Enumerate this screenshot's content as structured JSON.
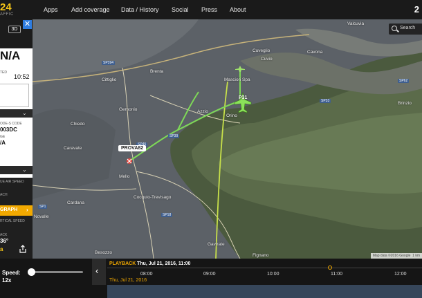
{
  "app": {
    "logo_text": "24",
    "logo_sub": "AFFIC"
  },
  "nav": {
    "items": [
      "Apps",
      "Add coverage",
      "Data / History",
      "Social",
      "Press",
      "About"
    ],
    "corner": "2"
  },
  "panel": {
    "view_3d": "3D",
    "close": "✕",
    "registration": "N/A",
    "time_label": "TED",
    "time_value": "10:52",
    "mode_s_label": "ODE-S CODE",
    "mode_s_value": "003DC",
    "section2_label": "GE",
    "section2_value": "/A",
    "airspeed_label": "UE AIR SPEED",
    "reach_label": "ACH",
    "graph_label": "GRAPH",
    "vspeed_label": "RTICAL SPEED",
    "back_label": "ACK",
    "back_value": "36°",
    "graph_yellow": "a"
  },
  "map": {
    "search_label": "Search",
    "callsign": "PROVA82",
    "flight_label": "P31",
    "attribution": "Map data ©2016 Google",
    "scale": "1 km",
    "towns": [
      {
        "name": "Cuvio"
      },
      {
        "name": "Cuveglio"
      },
      {
        "name": "Valcuvia"
      },
      {
        "name": "Cavona"
      },
      {
        "name": "Masciori Spa"
      },
      {
        "name": "Brinzio"
      },
      {
        "name": "Brenta"
      },
      {
        "name": "Azzio"
      },
      {
        "name": "Orino"
      },
      {
        "name": "Gemonio"
      },
      {
        "name": "Cittiglio"
      },
      {
        "name": "Chiedo"
      },
      {
        "name": "Caravate"
      },
      {
        "name": "Cocquio-Trevisago"
      },
      {
        "name": "Cardana"
      },
      {
        "name": "Besozzo"
      },
      {
        "name": "Gavirate"
      },
      {
        "name": "Mello"
      },
      {
        "name": "Fignano"
      },
      {
        "name": "Novalle"
      }
    ],
    "roads": [
      "SP394",
      "SP45",
      "SP62",
      "SP39",
      "SP1",
      "SP18",
      "SP33"
    ]
  },
  "playback": {
    "speed_label": "Speed:",
    "speed_value": "12x",
    "back_icon": "‹",
    "label": "PLAYBACK",
    "datetime": "Thu, Jul 21, 2016, 11:00",
    "date_small": "Thu, Jul 21, 2016",
    "ticks": [
      "08:00",
      "09:00",
      "10:00",
      "11:00",
      "12:00"
    ]
  }
}
